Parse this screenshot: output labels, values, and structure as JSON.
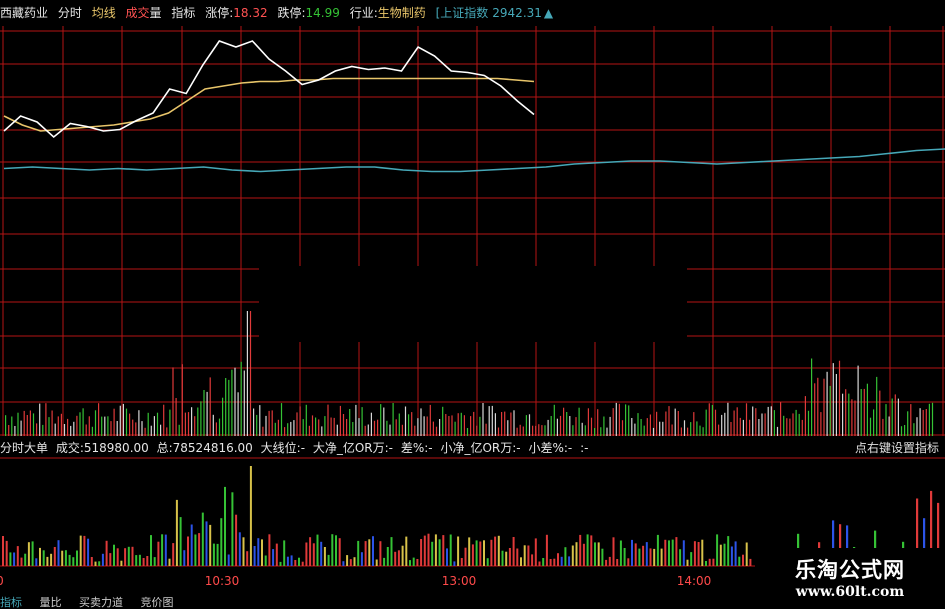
{
  "header": {
    "stock_name": "西藏药业",
    "tab_fenshi": "分时",
    "tab_junxian": "均线",
    "tab_chengjiao_a": "成交",
    "tab_chengjiao_b": "量",
    "tab_zhibiao": "指标",
    "limit_up_label": "涨停:",
    "limit_up_value": "18.32",
    "limit_down_label": "跌停:",
    "limit_down_value": "14.99",
    "industry_label": "行业:",
    "industry_value": "生物制药",
    "index_label": "[上证指数",
    "index_value": "2942.31",
    "index_arrow": "▲"
  },
  "indicator_bar": {
    "name": "分时大单",
    "volume": "成交:518980.00",
    "total": "总:78524816.00",
    "big_line": "大线位:-",
    "big_net": "大净_亿OR万:-",
    "diff": "差%:-",
    "small_net": "小净_亿OR万:-",
    "small_diff": "小差%:-",
    "trail": ":-",
    "hint": "点右键设置指标"
  },
  "time_axis": {
    "t1": "10:30",
    "t2": "13:00",
    "t3": "14:00",
    "left_cut": "0"
  },
  "bottom_tabs": [
    "指标",
    "量比",
    "买卖力道",
    "竞价图"
  ],
  "watermark": {
    "line1": "乐淘公式网",
    "line2": "www.60lt.com"
  },
  "colors": {
    "grid": "#b41414",
    "price": "#ffffff",
    "avg": "#e8c56a",
    "index": "#46a8b8",
    "up": "#e03a3a",
    "down": "#35c235",
    "flat": "#d8d8d8",
    "blue": "#2c54e8",
    "yellow": "#d8c24a"
  },
  "chart_data": {
    "type": "line",
    "series": [
      {
        "values": [
          0.3,
          0.4,
          0.36,
          0.26,
          0.35,
          0.33,
          0.3,
          0.31,
          0.37,
          0.42,
          0.58,
          0.55,
          0.74,
          0.9,
          0.86,
          0.9,
          0.78,
          0.7,
          0.61,
          0.64,
          0.7,
          0.73,
          0.71,
          0.72,
          0.7,
          0.86,
          0.8,
          0.7,
          0.69,
          0.67,
          0.6,
          0.5,
          0.41
        ]
      },
      {
        "values": [
          0.4,
          0.34,
          0.3,
          0.31,
          0.32,
          0.33,
          0.34,
          0.36,
          0.38,
          0.42,
          0.5,
          0.58,
          0.6,
          0.62,
          0.63,
          0.63,
          0.64,
          0.64,
          0.65,
          0.65,
          0.65,
          0.65,
          0.65,
          0.65,
          0.65,
          0.65,
          0.65,
          0.65,
          0.64,
          0.63
        ]
      },
      {
        "values": [
          0.05,
          0.06,
          0.05,
          0.04,
          0.05,
          0.04,
          0.05,
          0.06,
          0.04,
          0.03,
          0.04,
          0.05,
          0.06,
          0.06,
          0.04,
          0.03,
          0.03,
          0.04,
          0.05,
          0.06,
          0.08,
          0.09,
          0.1,
          0.1,
          0.09,
          0.08,
          0.09,
          0.1,
          0.11,
          0.12,
          0.13,
          0.15,
          0.17,
          0.18
        ]
      }
    ]
  }
}
